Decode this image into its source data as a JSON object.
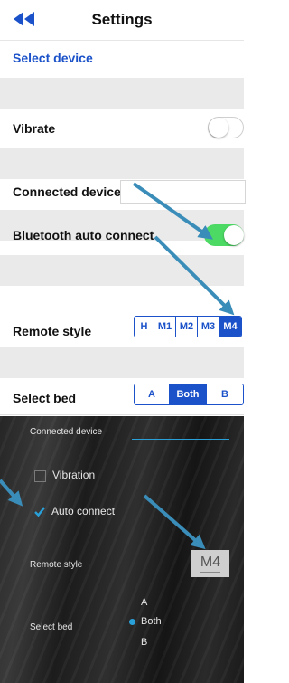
{
  "ios": {
    "title": "Settings",
    "select_device": "Select device",
    "vibrate_label": "Vibrate",
    "connected_device_label": "Connected device",
    "bluetooth_auto_connect_label": "Bluetooth auto connect",
    "remote_style_label": "Remote style",
    "remote_style_options": [
      "H",
      "M1",
      "M2",
      "M3",
      "M4"
    ],
    "remote_style_selected": "M4",
    "select_bed_label": "Select bed",
    "bed_options": [
      "A",
      "Both",
      "B"
    ],
    "bed_selected": "Both",
    "accent_color": "#1b52c9",
    "toggle_on_color": "#4cd964"
  },
  "android": {
    "connected_device_label": "Connected device",
    "vibration_label": "Vibration",
    "auto_connect_label": "Auto connect",
    "remote_style_label": "Remote style",
    "remote_style_value": "M4",
    "select_bed_label": "Select bed",
    "bed_options": [
      "A",
      "Both",
      "B"
    ],
    "bed_selected": "Both",
    "accent_color": "#2aa0d8"
  },
  "annotation_color": "#3a8db8"
}
